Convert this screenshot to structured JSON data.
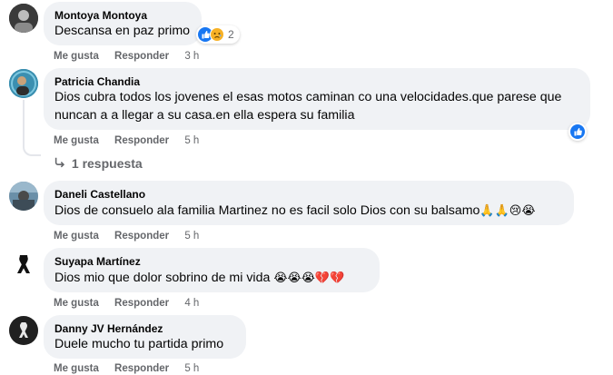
{
  "actions": {
    "like_label": "Me gusta",
    "reply_label": "Responder"
  },
  "comments": [
    {
      "author": "Montoya Montoya",
      "text": "Descansa en paz primo",
      "time": "3 h",
      "reactions": {
        "icons": [
          "like-icon",
          "sad-icon"
        ],
        "count": "2"
      }
    },
    {
      "author": "Patricia Chandia",
      "text_line1": "Dios cubra todos los jovenes el esas motos caminan co una velocidades.que parese que",
      "text_line2": "nuncan a a llegar a su casa.en ella espera su familia",
      "time": "5 h",
      "reactions": {
        "icons": [
          "like-icon"
        ]
      },
      "replies_label": "1 respuesta"
    },
    {
      "author": "Daneli Castellano",
      "text": "Dios de consuelo ala familia Martinez no es facil solo Dios con su balsamo",
      "emojis": "🙏🙏😢😭",
      "time": "5 h"
    },
    {
      "author": "Suyapa Martínez",
      "text": "Dios mio que dolor sobrino de mi vida",
      "emojis": "😭😭😭💔💔",
      "time": "4 h"
    },
    {
      "author": "Danny JV Hernández",
      "text": "Duele mucho tu partida primo",
      "time": "5 h"
    }
  ],
  "colors": {
    "bubble": "#f0f2f5",
    "meta_text": "#65676b",
    "like_blue": "#1877f2",
    "sad_yellow": "#f7b125"
  }
}
